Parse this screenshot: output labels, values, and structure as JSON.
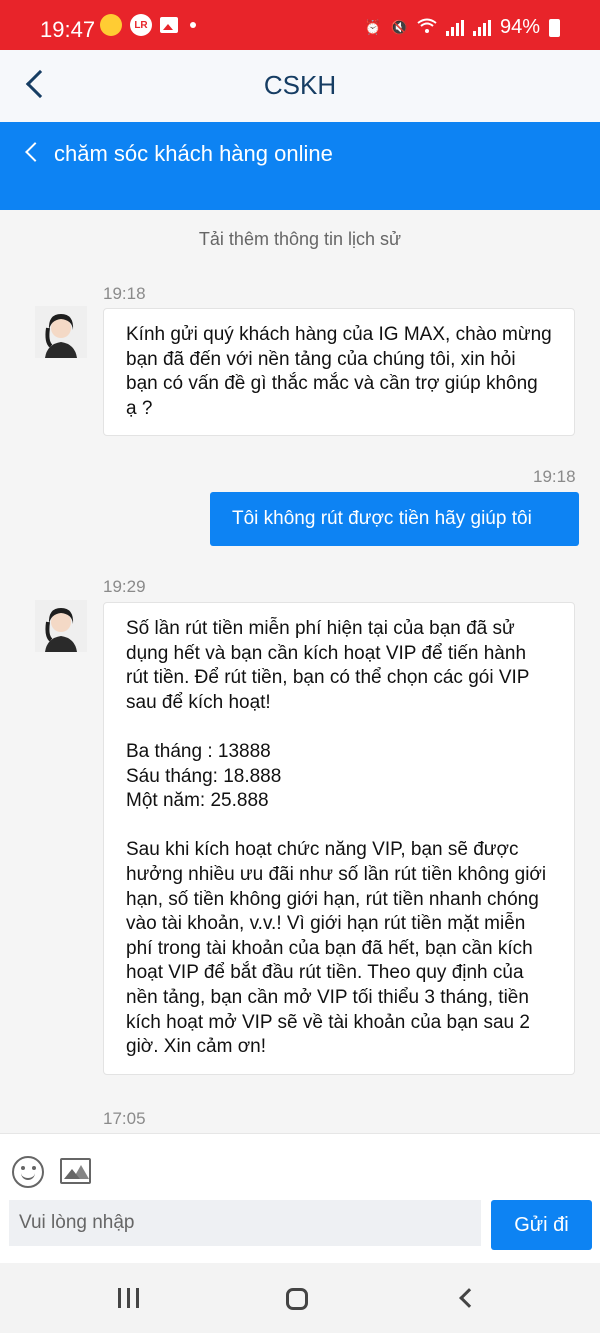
{
  "status_bar": {
    "time": "19:47",
    "battery": "94%",
    "icons": [
      "gear-icon",
      "lightroom-icon",
      "gallery-icon",
      "notification-dot",
      "alarm-icon",
      "mute-icon",
      "wifi-icon",
      "signal-icon",
      "signal-icon",
      "battery-icon"
    ]
  },
  "nav": {
    "title": "CSKH"
  },
  "banner": {
    "title": "chăm sóc khách hàng online"
  },
  "chat": {
    "load_history": "Tải thêm thông tin lịch sử",
    "messages": [
      {
        "time": "19:18",
        "direction": "in",
        "text": "Kính gửi quý khách hàng của IG MAX, chào mừng bạn đã đến với nền tảng của chúng tôi, xin hỏi bạn có vấn đề gì thắc mắc và cần trợ giúp không ạ ?"
      },
      {
        "time": "19:18",
        "direction": "out",
        "text": "Tôi không rút được tiền hãy giúp tôi"
      },
      {
        "time": "19:29",
        "direction": "in",
        "text": "Số lần rút tiền miễn phí hiện tại của bạn đã sử dụng hết và bạn cần kích hoạt VIP để tiến hành rút tiền. Để rút tiền, bạn có thể chọn các gói VIP sau để kích hoạt!\n\nBa tháng : 13888\nSáu tháng: 18.888\nMột năm: 25.888\n\nSau khi kích hoạt chức năng VIP, bạn sẽ được hưởng nhiều ưu đãi như số lần rút tiền không giới hạn, số tiền không giới hạn, rút tiền nhanh chóng vào tài khoản, v.v.! Vì giới hạn rút tiền mặt miễn phí trong tài khoản của bạn đã hết, bạn cần kích hoạt VIP để bắt đầu rút tiền. Theo quy định của nền tảng, bạn cần mở VIP tối thiểu 3 tháng, tiền kích hoạt mở VIP sẽ về tài khoản của bạn sau 2 giờ. Xin cảm ơn!"
      },
      {
        "time": "17:05",
        "direction": "in",
        "text": ""
      }
    ]
  },
  "composer": {
    "placeholder": "Vui lòng nhập",
    "send_label": "Gửi đi"
  },
  "colors": {
    "status_bar": "#e8242a",
    "accent": "#0d83f3",
    "nav_title": "#163d63"
  }
}
